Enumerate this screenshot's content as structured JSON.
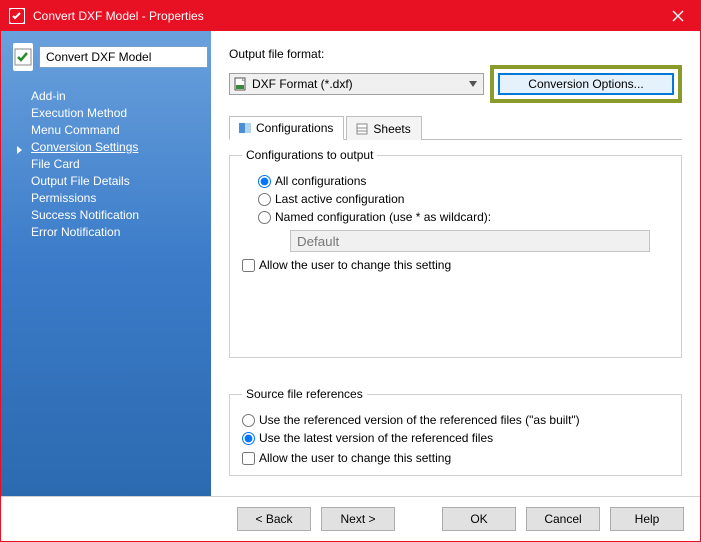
{
  "title": "Convert DXF Model - Properties",
  "task_name": "Convert DXF Model",
  "sidebar": {
    "items": [
      {
        "label": "Add-in"
      },
      {
        "label": "Execution Method"
      },
      {
        "label": "Menu Command"
      },
      {
        "label": "Conversion Settings",
        "active": true
      },
      {
        "label": "File Card"
      },
      {
        "label": "Output File Details"
      },
      {
        "label": "Permissions"
      },
      {
        "label": "Success Notification"
      },
      {
        "label": "Error Notification"
      }
    ]
  },
  "content": {
    "format_label": "Output file format:",
    "format_value": "DXF Format (*.dxf)",
    "conversion_button": "Conversion Options...",
    "tabs": {
      "configurations": "Configurations",
      "sheets": "Sheets"
    },
    "config_group": {
      "legend": "Configurations to output",
      "opt_all": "All configurations",
      "opt_last": "Last active configuration",
      "opt_named": "Named configuration (use * as wildcard):",
      "named_placeholder": "Default",
      "allow_change": "Allow the user to change this setting"
    },
    "source_group": {
      "legend": "Source file references",
      "opt_ref": "Use the referenced version of the referenced files (\"as built\")",
      "opt_latest": "Use the latest version of the referenced files",
      "allow_change": "Allow the user to change this setting"
    }
  },
  "footer": {
    "back": "< Back",
    "next": "Next >",
    "ok": "OK",
    "cancel": "Cancel",
    "help": "Help"
  }
}
